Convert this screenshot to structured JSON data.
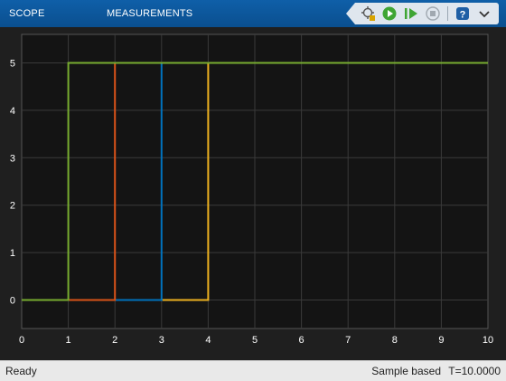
{
  "toolstrip": {
    "tabs": [
      {
        "label": "SCOPE"
      },
      {
        "label": "MEASUREMENTS"
      }
    ],
    "quick_access": [
      "highlight-signal-icon",
      "run-icon",
      "step-forward-icon",
      "stop-icon",
      "help-icon",
      "expand-icon"
    ]
  },
  "status": {
    "state": "Ready",
    "mode": "Sample based",
    "time": "T=10.0000"
  },
  "colors": {
    "background": "#141414",
    "grid": "#3a3a3a",
    "axis_text": "#ffffff",
    "green": "#77ac30",
    "orange": "#d95319",
    "blue": "#0072bd",
    "yellow": "#edb120"
  },
  "chart_data": {
    "type": "line",
    "xlim": [
      0,
      10
    ],
    "ylim": [
      -0.6,
      5.6
    ],
    "x_ticks": [
      0,
      1,
      2,
      3,
      4,
      5,
      6,
      7,
      8,
      9,
      10
    ],
    "y_ticks": [
      0,
      1,
      2,
      3,
      4,
      5
    ],
    "grid": true,
    "series": [
      {
        "color": "#edb120",
        "x": [
          0,
          4,
          4,
          10
        ],
        "y": [
          0,
          0,
          5,
          5
        ]
      },
      {
        "color": "#0072bd",
        "x": [
          0,
          3,
          3,
          10
        ],
        "y": [
          0,
          0,
          5,
          5
        ]
      },
      {
        "color": "#d95319",
        "x": [
          0,
          2,
          2,
          10
        ],
        "y": [
          0,
          0,
          5,
          5
        ]
      },
      {
        "color": "#77ac30",
        "x": [
          0,
          1,
          1,
          10
        ],
        "y": [
          0,
          0,
          5,
          5
        ]
      }
    ]
  }
}
